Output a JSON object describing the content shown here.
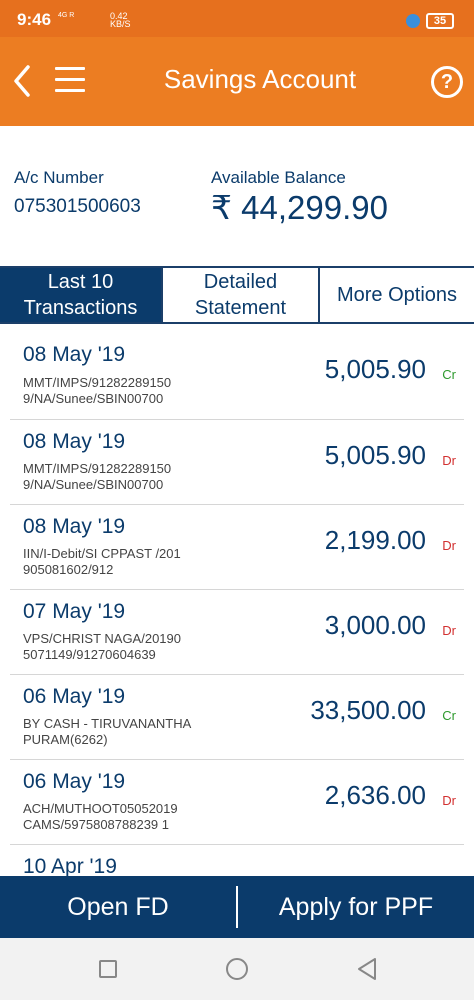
{
  "status_bar": {
    "time": "9:46",
    "signal_text": "4G R",
    "network_speed": "0.42",
    "network_unit": "KB/S",
    "battery": "35"
  },
  "header": {
    "title": "Savings Account",
    "help_label": "?"
  },
  "account": {
    "number_label": "A/c Number",
    "number": "075301500603",
    "balance_label": "Available Balance",
    "balance": "₹ 44,299.90"
  },
  "tabs": [
    {
      "label_line1": "Last 10",
      "label_line2": "Transactions"
    },
    {
      "label_line1": "Detailed",
      "label_line2": "Statement"
    },
    {
      "label": "More Options"
    }
  ],
  "transactions": [
    {
      "date": "08 May '19",
      "desc1": "MMT/IMPS/91282289150",
      "desc2": "9/NA/Sunee/SBIN00700",
      "amount": "5,005.90",
      "type": "Cr"
    },
    {
      "date": "08 May '19",
      "desc1": "MMT/IMPS/91282289150",
      "desc2": "9/NA/Sunee/SBIN00700",
      "amount": "5,005.90",
      "type": "Dr"
    },
    {
      "date": "08 May '19",
      "desc1": "IIN/I-Debit/SI CPPAST /201",
      "desc2": "905081602/912",
      "amount": "2,199.00",
      "type": "Dr"
    },
    {
      "date": "07 May '19",
      "desc1": "VPS/CHRIST NAGA/20190",
      "desc2": "5071149/91270604639",
      "amount": "3,000.00",
      "type": "Dr"
    },
    {
      "date": "06 May '19",
      "desc1": "BY CASH - TIRUVANANTHA",
      "desc2": "PURAM(6262)",
      "amount": "33,500.00",
      "type": "Cr"
    },
    {
      "date": "06 May '19",
      "desc1": "ACH/MUTHOOT05052019",
      "desc2": "CAMS/5975808788239 1",
      "amount": "2,636.00",
      "type": "Dr"
    },
    {
      "date": "10 Apr '19",
      "desc1": "",
      "desc2": "",
      "amount": "",
      "type": ""
    }
  ],
  "actions": {
    "open_fd": "Open FD",
    "apply_ppf": "Apply for PPF"
  },
  "colors": {
    "brand_orange": "#ec7d22",
    "navy": "#0b3b6b",
    "credit_green": "#2e9a2e",
    "debit_red": "#d23030"
  }
}
